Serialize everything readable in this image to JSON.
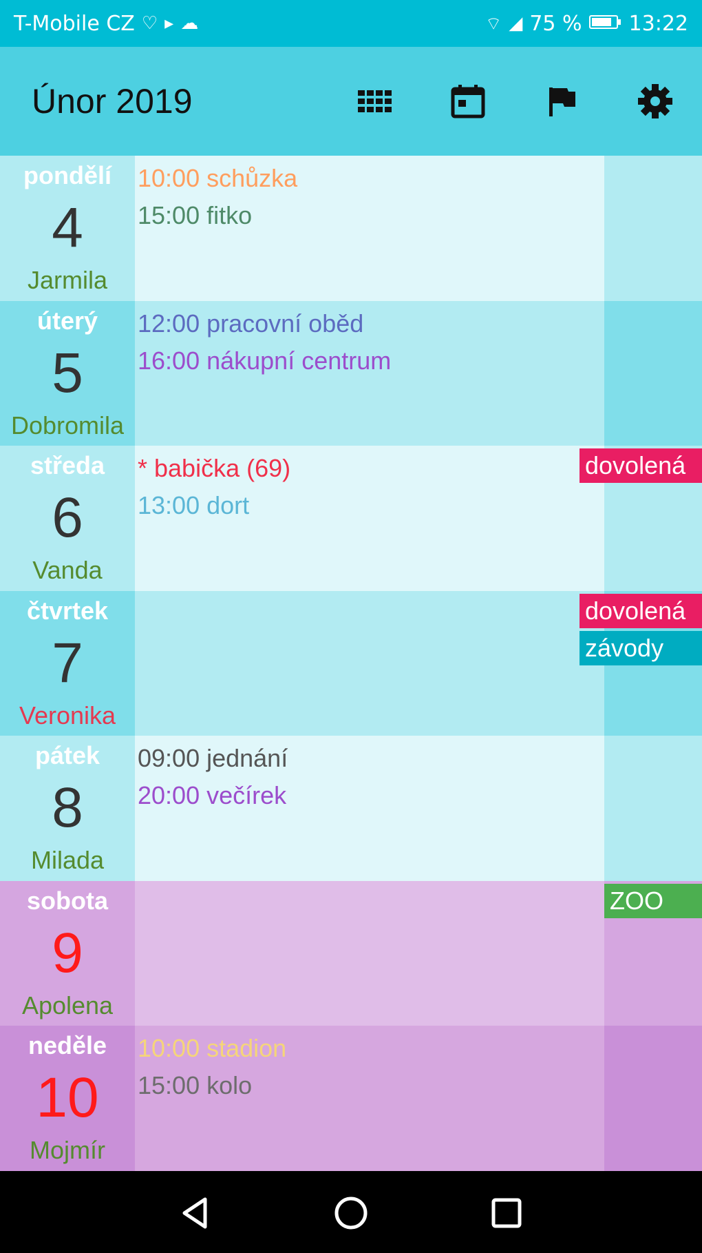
{
  "status_bar": {
    "carrier": "T-Mobile CZ",
    "battery": "75 %",
    "time": "13:22"
  },
  "header": {
    "title": "Únor 2019",
    "icons": [
      "grid-icon",
      "calendar-today-icon",
      "flag-icon",
      "gear-icon"
    ]
  },
  "days": [
    {
      "name": "pondělí",
      "number": "4",
      "nameday": "Jarmila",
      "colors": {
        "left": "#b2ebf2",
        "main": "#e0f7fa",
        "side": "#b2ebf2"
      },
      "events": [
        {
          "text": "10:00 schůzka",
          "color": "#ff9e5e"
        },
        {
          "text": "15:00 fitko",
          "color": "#4e8a68"
        }
      ],
      "tags": []
    },
    {
      "name": "úterý",
      "number": "5",
      "nameday": "Dobromila",
      "colors": {
        "left": "#80deea",
        "main": "#b2ebf2",
        "side": "#80deea"
      },
      "events": [
        {
          "text": "12:00 pracovní oběd",
          "color": "#5c6bc0"
        },
        {
          "text": "16:00 nákupní centrum",
          "color": "#9c4dcc"
        }
      ],
      "tags": []
    },
    {
      "name": "středa",
      "number": "6",
      "nameday": "Vanda",
      "colors": {
        "left": "#b2ebf2",
        "main": "#e0f7fa",
        "side": "#b2ebf2"
      },
      "events": [
        {
          "text": "* babička (69)",
          "color": "#f0304a"
        },
        {
          "text": "13:00 dort",
          "color": "#5bb6d6"
        }
      ],
      "tags": [
        {
          "text": "dovolená",
          "color": "#e91e63"
        }
      ]
    },
    {
      "name": "čtvrtek",
      "number": "7",
      "nameday": "Veronika",
      "nameday_red": true,
      "colors": {
        "left": "#80deea",
        "main": "#b2ebf2",
        "side": "#80deea"
      },
      "events": [],
      "tags": [
        {
          "text": "dovolená",
          "color": "#e91e63"
        },
        {
          "text": "závody",
          "color": "#00acc1"
        }
      ]
    },
    {
      "name": "pátek",
      "number": "8",
      "nameday": "Milada",
      "colors": {
        "left": "#b2ebf2",
        "main": "#e0f7fa",
        "side": "#b2ebf2"
      },
      "events": [
        {
          "text": "09:00 jednání",
          "color": "#555555"
        },
        {
          "text": "20:00 večírek",
          "color": "#9c4dcc"
        }
      ],
      "tags": []
    },
    {
      "name": "sobota",
      "number": "9",
      "nameday": "Apolena",
      "number_red": true,
      "colors": {
        "left": "#d5a6e0",
        "main": "#e0bde8",
        "side": "#d5a6e0"
      },
      "events": [],
      "tags": [
        {
          "text": "ZOO",
          "color": "#4caf50"
        }
      ]
    },
    {
      "name": "neděle",
      "number": "10",
      "nameday": "Mojmír",
      "number_red": true,
      "colors": {
        "left": "#c990d8",
        "main": "#d6a7df",
        "side": "#c990d8"
      },
      "events": [
        {
          "text": "10:00 stadion",
          "color": "#f5d57a"
        },
        {
          "text": "15:00 kolo",
          "color": "#6d6d6d"
        }
      ],
      "tags": []
    }
  ]
}
